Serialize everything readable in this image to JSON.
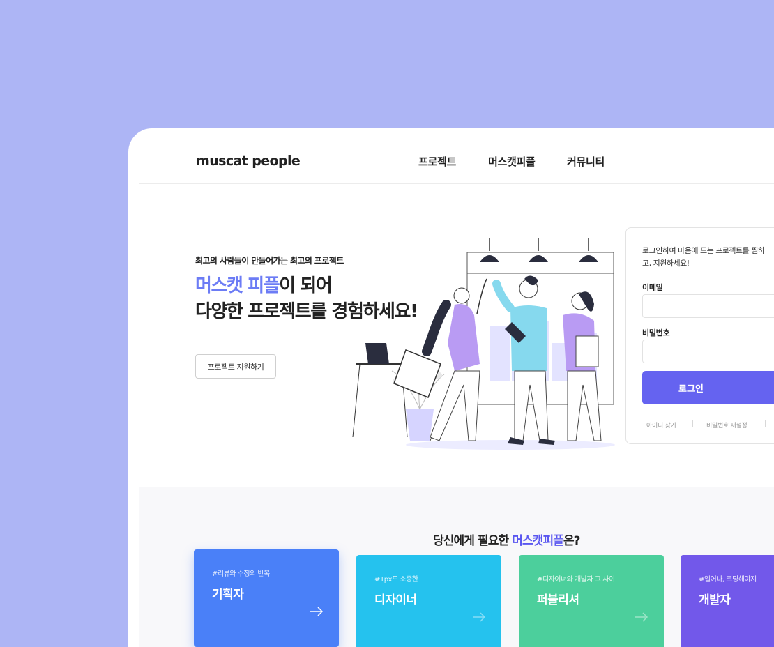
{
  "nav": {
    "logo": "muscat people",
    "items": [
      "프로젝트",
      "머스캣피플",
      "커뮤니티"
    ]
  },
  "hero": {
    "eyebrow": "최고의 사람들이 만들어가는 최고의 프로젝트",
    "headline_accent": "머스캣 피플",
    "headline_rest1": "이 되어",
    "headline_line2": "다양한 프로젝트를 경험하세요!",
    "apply_button": "프로젝트 지원하기"
  },
  "login": {
    "intro": "로그인하여 마음에 드는 프로젝트를 찜하고, 지원하세요!",
    "email_label": "이메일",
    "email_value": "",
    "password_label": "비밀번호",
    "password_value": "",
    "submit": "로그인",
    "find_id": "아이디 찾기",
    "reset_password": "비밀번호 재설정"
  },
  "roles": {
    "title_prefix": "당신에게 필요한",
    "title_accent": "머스캣피플",
    "title_suffix": "은?",
    "cards": [
      {
        "tag": "#리뷰와 수정의 반복",
        "name": "기획자",
        "color": "#4a80f8"
      },
      {
        "tag": "#1px도 소중한",
        "name": "디자이너",
        "color": "#25c2ee"
      },
      {
        "tag": "#디자이너와 개발자 그 사이",
        "name": "퍼블리셔",
        "color": "#4ccf9c"
      },
      {
        "tag": "#일어나, 코딩해야지",
        "name": "개발자",
        "color": "#7258ea"
      }
    ]
  },
  "colors": {
    "background": "#adb5f5",
    "accent": "#6c7cf5",
    "login_button": "#6563f0"
  }
}
